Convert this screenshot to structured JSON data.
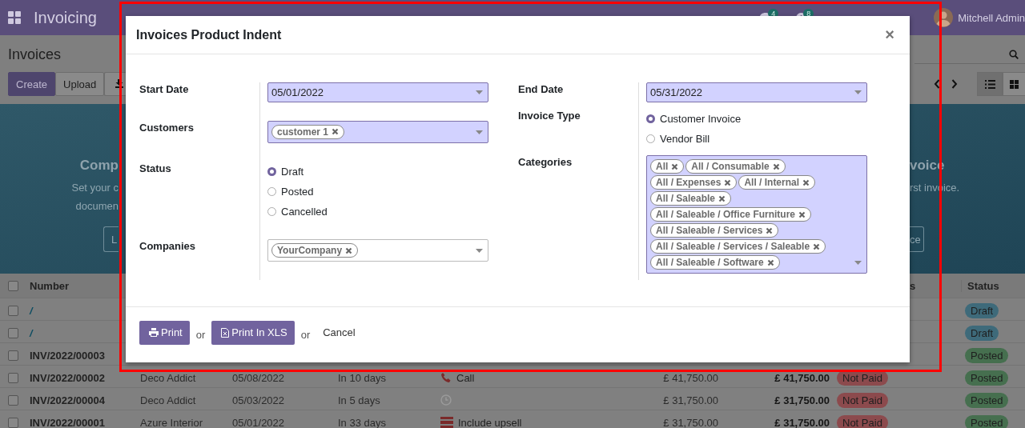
{
  "navbar": {
    "app_title": "Invoicing",
    "chat_count": "4",
    "activity_count": "8",
    "user": "Mitchell Admin"
  },
  "control_panel": {
    "title": "Invoices",
    "buttons": [
      "Create",
      "Upload"
    ]
  },
  "banner": {
    "left_heading": "Comp",
    "left_lines": [
      "Set your c",
      "documen"
    ],
    "left_button": "L",
    "right_heading": "voice",
    "right_line": "rst invoice.",
    "right_button": "ce"
  },
  "table": {
    "columns": [
      "Number",
      "s",
      "Status"
    ],
    "all_checked": false,
    "rows": [
      {
        "kind": "draft",
        "checked": false,
        "number": "/",
        "status": {
          "label": "Draft",
          "color": "#3e6a7a"
        }
      },
      {
        "kind": "draft",
        "checked": false,
        "number": "/",
        "status": {
          "label": "Draft",
          "color": "#3e6a7a"
        }
      },
      {
        "kind": "posted",
        "checked": false,
        "number": "INV/2022/00003",
        "status": {
          "label": "Posted",
          "color": "#466f4f"
        }
      },
      {
        "kind": "posted",
        "checked": false,
        "number": "INV/2022/00002",
        "customer": "Deco Addict",
        "date": "05/08/2022",
        "due": "In 10 days",
        "activity": {
          "kind": "phone",
          "label": "Call"
        },
        "untaxed": "£ 41,750.00",
        "total": "£ 41,750.00",
        "payment": {
          "label": "Not Paid",
          "color": "#8c4a4d"
        },
        "status": {
          "label": "Posted",
          "color": "#466f4f"
        }
      },
      {
        "kind": "posted",
        "checked": false,
        "number": "INV/2022/00004",
        "customer": "Deco Addict",
        "date": "05/03/2022",
        "due": "In 5 days",
        "activity": {
          "kind": "clock"
        },
        "untaxed": "£ 31,750.00",
        "total": "£ 31,750.00",
        "payment": {
          "label": "Not Paid",
          "color": "#8c4a4d"
        },
        "status": {
          "label": "Posted",
          "color": "#466f4f"
        }
      },
      {
        "kind": "posted",
        "checked": false,
        "number": "INV/2022/00001",
        "customer": "Azure Interior",
        "date": "05/01/2022",
        "due": "In 33 days",
        "activity": {
          "kind": "stack",
          "label": "Include upsell"
        },
        "untaxed": "£ 31,750.00",
        "total": "£ 31,750.00",
        "payment": {
          "label": "Not Paid",
          "color": "#8c4a4d"
        },
        "status": {
          "label": "Posted",
          "color": "#466f4f"
        }
      }
    ]
  },
  "dialog": {
    "title": "Invoices Product Indent",
    "close": "×",
    "left_fields": [
      {
        "kind": "date",
        "label": "Start Date",
        "value": "05/01/2022",
        "required": true
      },
      {
        "kind": "tags",
        "label": "Customers",
        "tags": [
          "customer 1"
        ],
        "required": true
      },
      {
        "kind": "radio",
        "label": "Status",
        "options": [
          {
            "label": "Draft",
            "selected": true
          },
          {
            "label": "Posted",
            "selected": false
          },
          {
            "label": "Cancelled",
            "selected": false
          }
        ]
      },
      {
        "kind": "tags",
        "label": "Companies",
        "tags": [
          "YourCompany"
        ],
        "required": false
      }
    ],
    "right_fields": [
      {
        "kind": "date",
        "label": "End Date",
        "value": "05/31/2022",
        "required": true
      },
      {
        "kind": "radio",
        "label": "Invoice Type",
        "options": [
          {
            "label": "Customer Invoice",
            "selected": true
          },
          {
            "label": "Vendor Bill",
            "selected": false
          }
        ]
      },
      {
        "kind": "tags",
        "label": "Categories",
        "tags": [
          "All",
          "All / Consumable",
          "All / Expenses",
          "All / Internal",
          "All / Saleable",
          "All / Saleable / Office Furniture",
          "All / Saleable / Services",
          "All / Saleable / Services / Saleable",
          "All / Saleable / Software"
        ],
        "required": true
      }
    ],
    "actions": [
      {
        "kind": "print",
        "label": "Print"
      },
      {
        "kind": "text",
        "label": "or"
      },
      {
        "kind": "xls",
        "label": "Print In XLS"
      },
      {
        "kind": "text",
        "label": "or"
      },
      {
        "kind": "link",
        "label": "Cancel"
      }
    ]
  }
}
